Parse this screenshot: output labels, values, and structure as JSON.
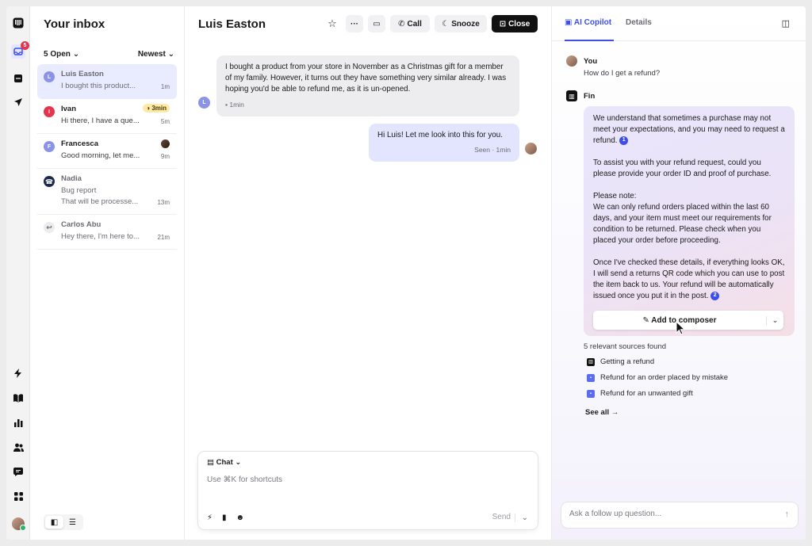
{
  "rail": {
    "inbox_badge": "5",
    "icons": [
      "app-logo-icon",
      "inbox-icon",
      "ticket-icon",
      "send-icon",
      "bolt-icon",
      "book-icon",
      "chart-icon",
      "people-icon",
      "message-icon",
      "apps-icon"
    ]
  },
  "inbox": {
    "title": "Your inbox",
    "filter": "5 Open",
    "sort": "Newest",
    "conversations": [
      {
        "initial": "L",
        "name": "Luis Easton",
        "preview": "I bought this product...",
        "time": "1m",
        "color": "#8a93e8"
      },
      {
        "initial": "I",
        "name": "Ivan",
        "preview": "Hi there, I have a que...",
        "time": "5m",
        "timer": "3min",
        "color": "#e5344d"
      },
      {
        "initial": "F",
        "name": "Francesca",
        "preview": "Good morning, let me...",
        "time": "9m",
        "color": "#8a93e8"
      },
      {
        "name": "Nadia",
        "subject": "Bug report",
        "preview": "That will be processe...",
        "time": "13m",
        "color": "#1d2a4d"
      },
      {
        "name": "Carlos Abu",
        "preview": "Hey there, I'm here to...",
        "time": "21m",
        "color": "#e2e2e6"
      }
    ]
  },
  "conversation": {
    "title": "Luis Easton",
    "buttons": {
      "call": "Call",
      "snooze": "Snooze",
      "close": "Close"
    },
    "messages": {
      "incoming": {
        "text": "I bought a product from your store in November as a Christmas gift for a member of my family. However, it turns out they have something very similar already. I was hoping you'd be able to refund me, as it is un-opened.",
        "meta": "1min",
        "initial": "L"
      },
      "outgoing": {
        "text": "Hi Luis! Let me look into this for you.",
        "meta": "Seen · 1min"
      }
    },
    "composer": {
      "mode": "Chat",
      "placeholder": "Use ⌘K for shortcuts",
      "send": "Send"
    }
  },
  "copilot": {
    "tabs": {
      "copilot": "AI Copilot",
      "details": "Details"
    },
    "you": {
      "name": "You",
      "question": "How do I get a refund?"
    },
    "fin": {
      "name": "Fin",
      "p1": "We understand that sometimes a purchase may not meet your expectations, and you may need to request a refund.",
      "p2": "To assist you with your refund request, could you please provide your order ID and proof of purchase.",
      "p3_head": "Please note:",
      "p3": "We can only refund orders placed within the last 60 days, and your item must meet our requirements for condition to be returned. Please check when you placed your order before proceeding.",
      "p4": "Once I've checked these details, if everything looks OK, I will send a returns QR code which you can use to post the item back to us. Your refund will be automatically issued once you put it in the post.",
      "cite1": "1",
      "cite2": "2",
      "add_label": "Add to composer"
    },
    "sources_title": "5 relevant sources found",
    "sources": [
      "Getting a refund",
      "Refund for an order placed by mistake",
      "Refund for an unwanted gift"
    ],
    "see_all": "See all →",
    "followup_placeholder": "Ask a follow up question..."
  },
  "colors": {
    "accent": "#3d4eea",
    "danger": "#e5344d",
    "timer": "#fde9a8"
  }
}
